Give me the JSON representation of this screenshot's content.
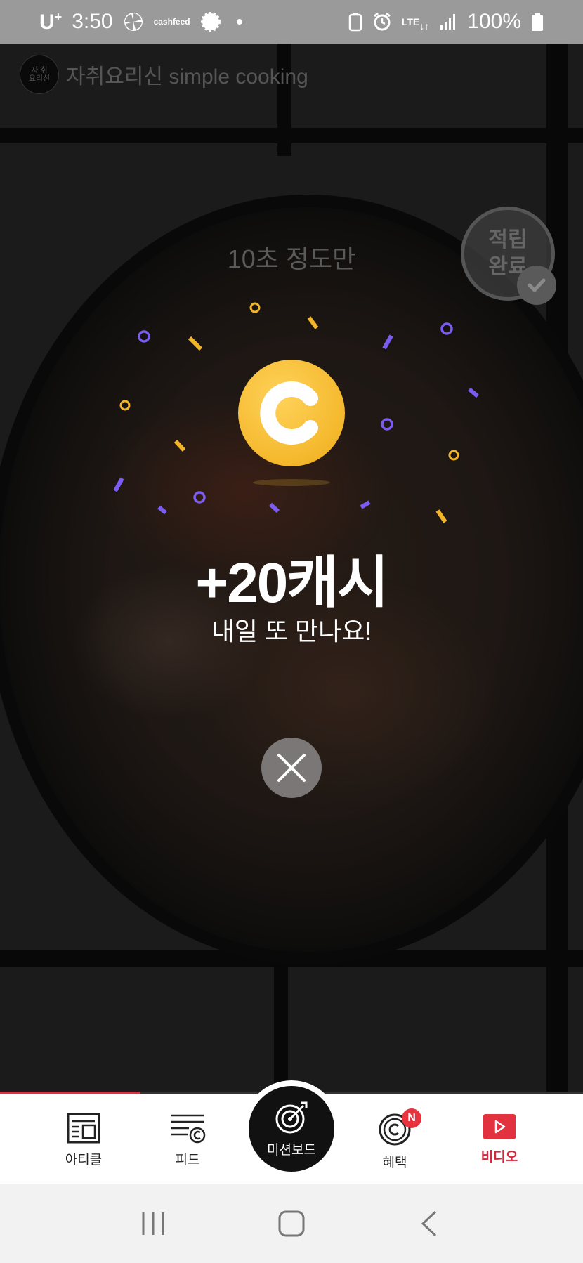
{
  "status_bar": {
    "carrier": "U",
    "carrier_sup": "+",
    "time": "3:50",
    "cashfeed_line1": "cash",
    "cashfeed_line2": "feed",
    "network_top": "LTE",
    "battery_text": "100%"
  },
  "video": {
    "channel_avatar_text": "자 취\n요 리 신",
    "channel_name": "자취요리신 simple cooking",
    "subtitle": "10초 정도만",
    "badge_line1": "적립",
    "badge_line2": "완료",
    "progress_percent": 24
  },
  "reward": {
    "coin_symbol": "C",
    "amount": "+20캐시",
    "message": "내일 또 만나요!"
  },
  "tabs": [
    {
      "label": "아티클",
      "icon": "article-icon"
    },
    {
      "label": "피드",
      "icon": "feed-icon"
    },
    {
      "label": "미션보드",
      "icon": "target-icon"
    },
    {
      "label": "혜택",
      "icon": "benefit-coin-icon",
      "badge": "N"
    },
    {
      "label": "비디오",
      "icon": "video-play-icon",
      "active": true
    }
  ],
  "colors": {
    "coin": "#f4b82c",
    "confetti_purple": "#7a5cf0",
    "confetti_yellow": "#f2b52a",
    "active_tab": "#d7263d",
    "badge": "#e8333f"
  }
}
